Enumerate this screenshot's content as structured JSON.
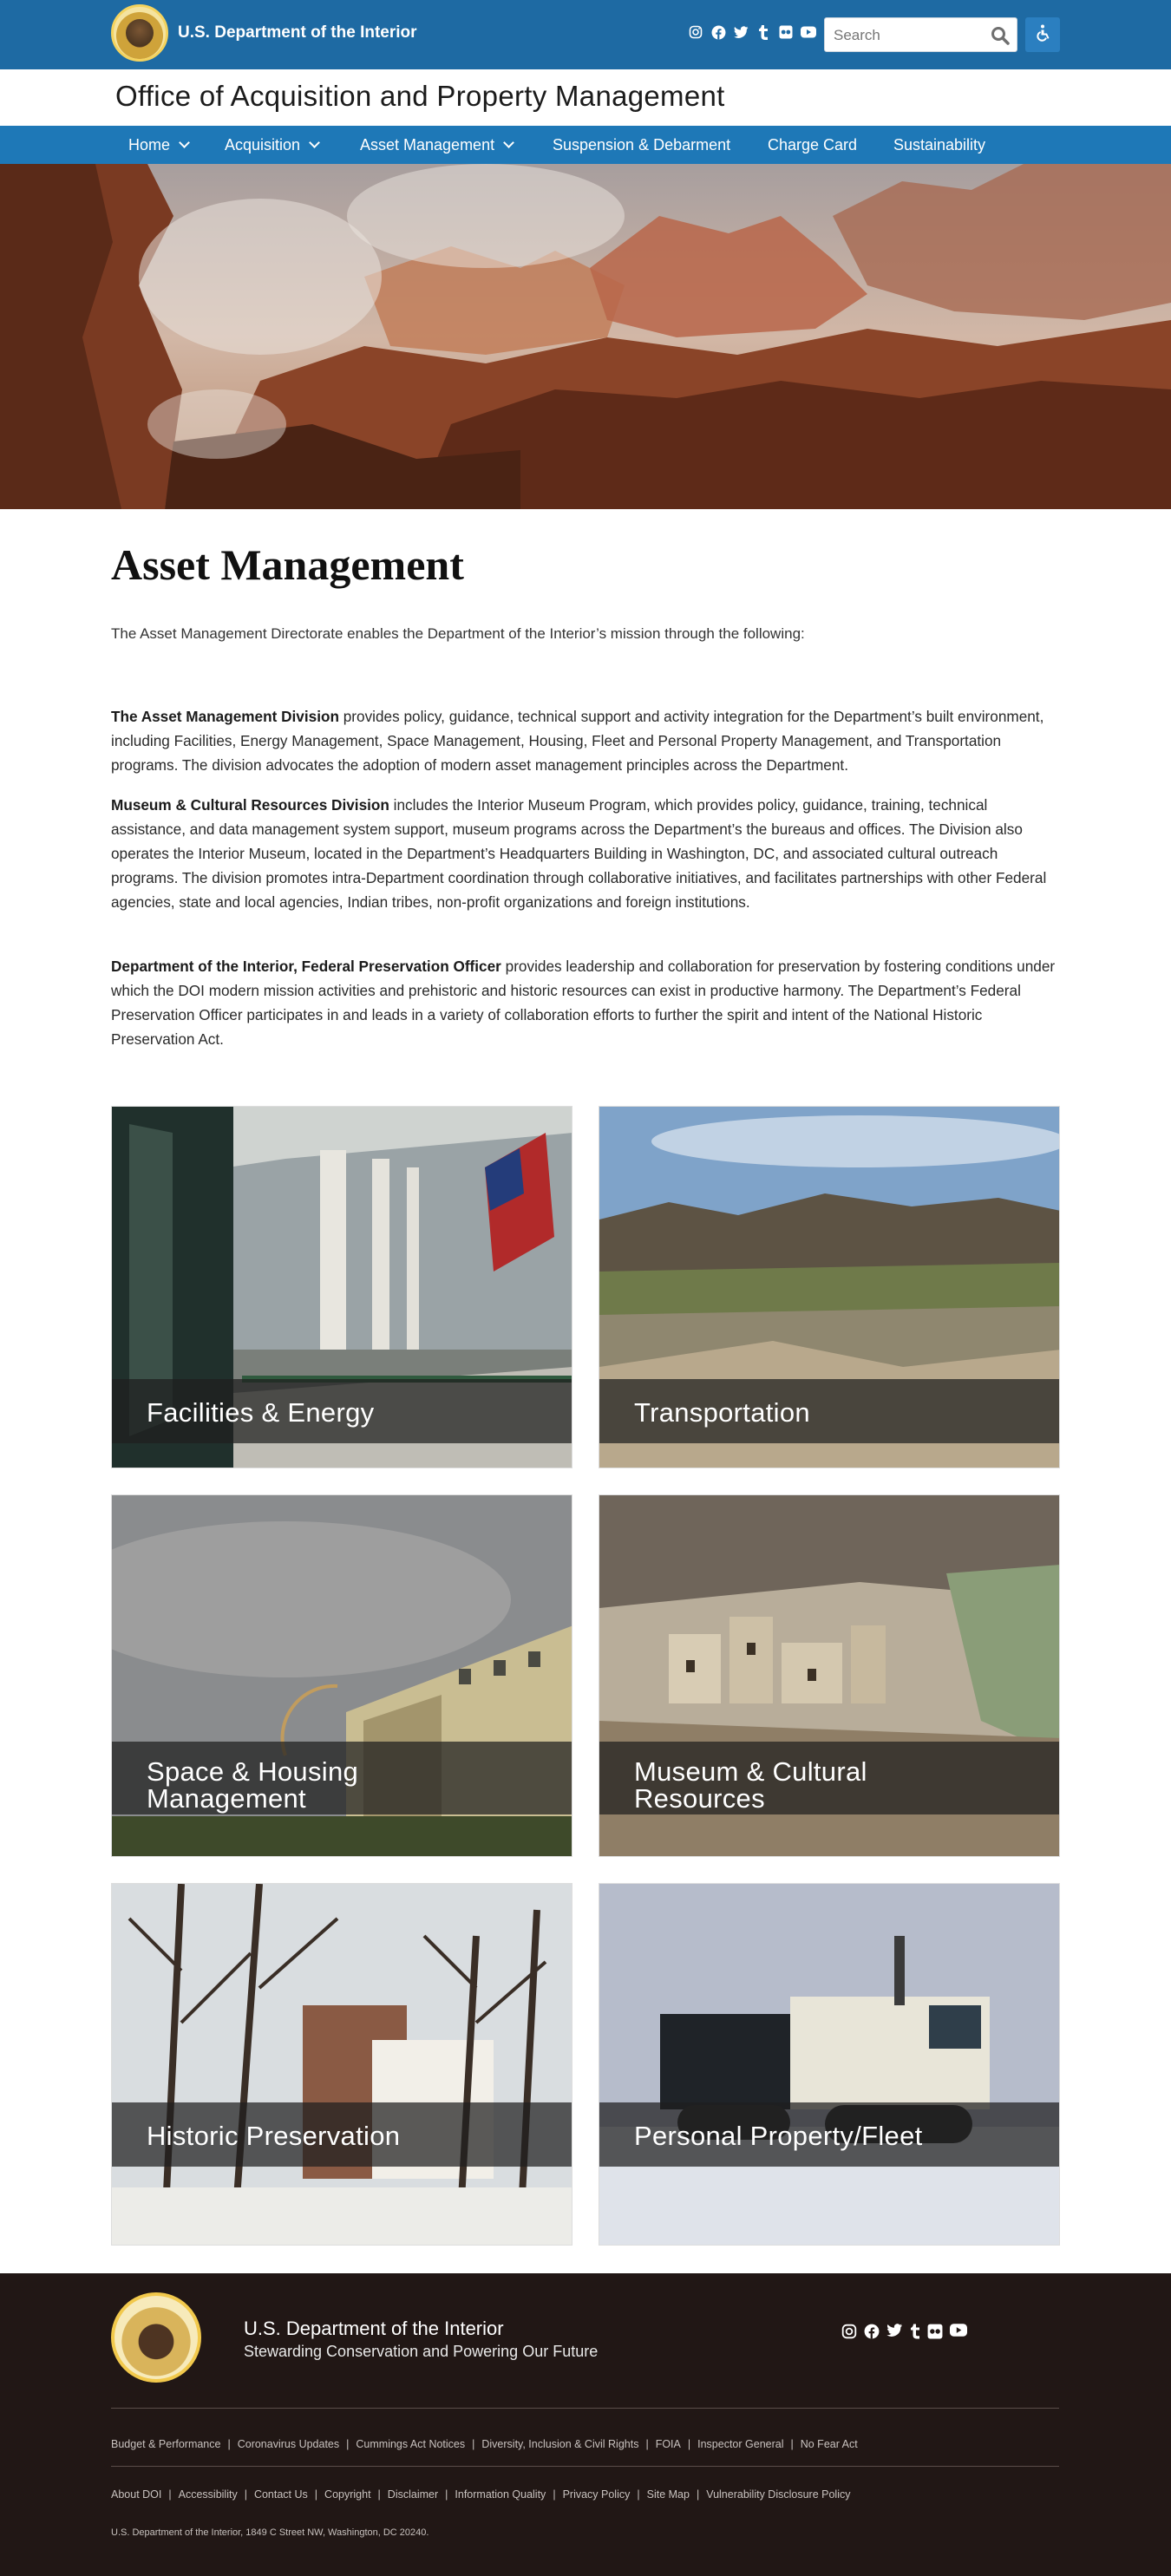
{
  "header": {
    "org_name": "U.S. Department of the Interior",
    "search_placeholder": "Search",
    "social_icons": [
      "instagram-icon",
      "facebook-icon",
      "twitter-icon",
      "tumblr-icon",
      "flickr-icon",
      "youtube-icon"
    ]
  },
  "site": {
    "name": "Office of Acquisition and Property Management"
  },
  "nav": {
    "items": [
      {
        "label": "Home",
        "has_dropdown": true
      },
      {
        "label": "Acquisition",
        "has_dropdown": true
      },
      {
        "label": "Asset Management",
        "has_dropdown": true
      },
      {
        "label": "Suspension & Debarment",
        "has_dropdown": false
      },
      {
        "label": "Charge Card",
        "has_dropdown": false
      },
      {
        "label": "Sustainability",
        "has_dropdown": false
      }
    ]
  },
  "main": {
    "title": "Asset Management",
    "intro": "The Asset Management Directorate enables the Department of the Interior’s mission through the following:",
    "paragraphs": [
      {
        "bold": "The Asset Management Division",
        "text": " provides policy, guidance, technical support and activity integration for the Department’s built environment, including Facilities, Energy Management, Space Management, Housing, Fleet and Personal Property Management, and Transportation programs.  The division advocates the adoption of modern asset management principles across the Department."
      },
      {
        "bold": "Museum & Cultural Resources Division",
        "text": " includes the Interior Museum Program, which provides policy, guidance, training, technical assistance, and data management system support, museum programs across the Department’s the bureaus and offices. The Division also operates the Interior Museum, located in the Department’s Headquarters Building in Washington, DC, and associated cultural outreach programs. The division promotes intra-Department coordination through collaborative initiatives, and facilitates partnerships with other Federal agencies, state and local agencies, Indian tribes, non-profit organizations and foreign institutions."
      },
      {
        "bold": "Department of the Interior, Federal Preservation Officer",
        "text": " provides leadership and collaboration for preservation by fostering conditions under which the DOI modern mission activities and prehistoric and historic resources can exist in productive harmony. The Department’s Federal Preservation Officer participates in and leads in a variety of collaboration efforts to further the spirit and intent of the National Historic Preservation Act."
      }
    ],
    "cards": [
      {
        "label": "Facilities & Energy"
      },
      {
        "label": "Transportation"
      },
      {
        "label": "Space & Housing Management"
      },
      {
        "label": "Museum & Cultural Resources"
      },
      {
        "label": "Historic Preservation"
      },
      {
        "label": "Personal Property/Fleet"
      }
    ]
  },
  "footer": {
    "title": "U.S. Department of the Interior",
    "tagline": "Stewarding Conservation and Powering Our Future",
    "links_row1": [
      "Budget & Performance",
      "Coronavirus Updates",
      "Cummings Act Notices",
      "Diversity, Inclusion & Civil Rights",
      "FOIA",
      "Inspector General",
      "No Fear Act"
    ],
    "links_row2": [
      "About DOI",
      "Accessibility",
      "Contact Us",
      "Copyright",
      "Disclaimer",
      "Information Quality",
      "Privacy Policy",
      "Site Map",
      "Vulnerability Disclosure Policy"
    ],
    "address": "U.S. Department of the Interior, 1849 C Street NW, Washington, DC 20240."
  },
  "colors": {
    "topbar": "#1e6aa3",
    "nav": "#1e78b7",
    "footer": "#211715"
  }
}
